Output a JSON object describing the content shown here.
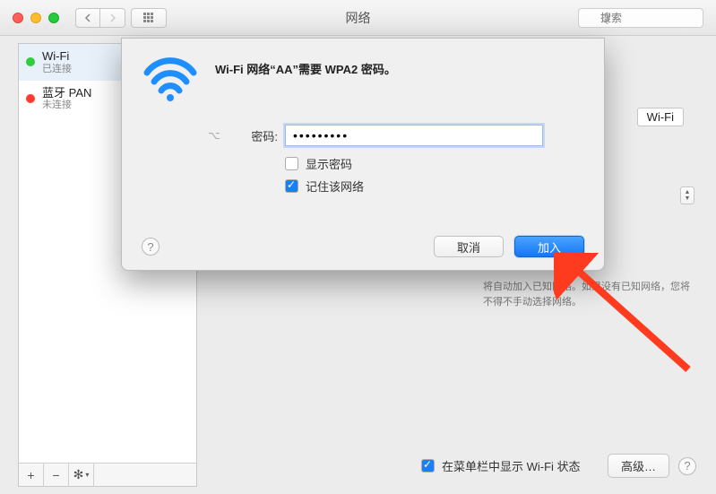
{
  "window": {
    "title": "网络",
    "search_placeholder": "搜索"
  },
  "sidebar": {
    "items": [
      {
        "name": "Wi-Fi",
        "status": "已连接",
        "dot": "green"
      },
      {
        "name": "蓝牙 PAN",
        "status": "未连接",
        "dot": "red"
      }
    ],
    "footer": {
      "add": "+",
      "remove": "−",
      "gear": "✻"
    }
  },
  "main": {
    "wifi_label": "Wi-Fi",
    "auto_join_text": "将自动加入已知网络。如果没有已知网络，您将不得不手动选择网络。",
    "menubar_checkbox": "在菜单栏中显示 Wi-Fi 状态",
    "advanced_button": "高级…"
  },
  "modal": {
    "title": "Wi-Fi 网络“AA”需要 WPA2 密码。",
    "password_label": "密码:",
    "password_value": "•••••••••",
    "show_password": "显示密码",
    "remember_network": "记住该网络",
    "cancel": "取消",
    "join": "加入"
  }
}
